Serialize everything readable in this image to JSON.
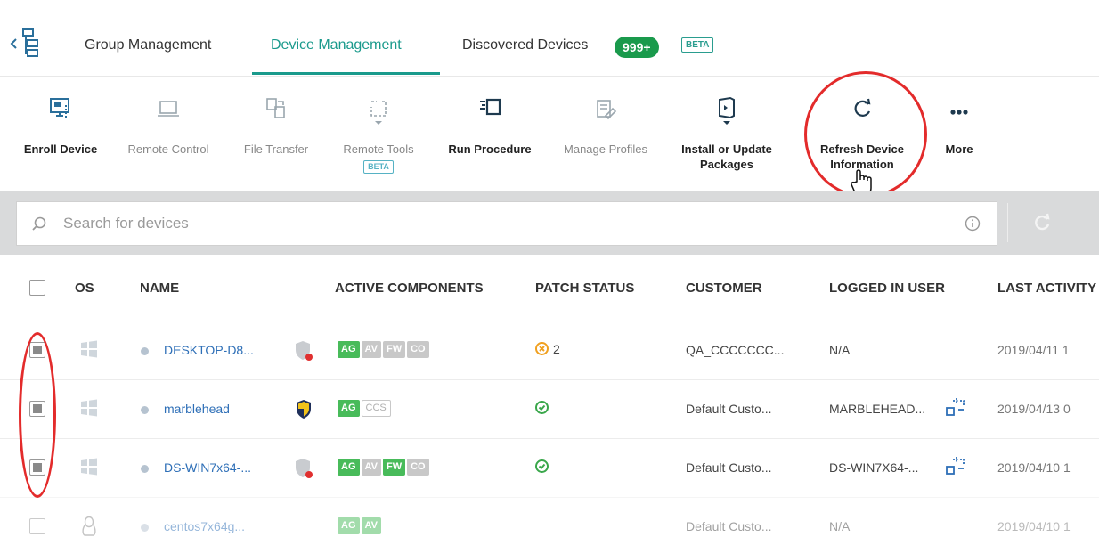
{
  "tabs": {
    "items": [
      {
        "label": "Group Management"
      },
      {
        "label": "Device Management"
      },
      {
        "label": "Discovered Devices"
      }
    ],
    "discovered_count": "999+",
    "discovered_beta": "BETA"
  },
  "toolbar": {
    "enroll": "Enroll Device",
    "remote_control": "Remote Control",
    "file_transfer": "File Transfer",
    "remote_tools": "Remote Tools",
    "remote_tools_beta": "BETA",
    "run_procedure": "Run Procedure",
    "manage_profiles": "Manage Profiles",
    "install_update": "Install or Update Packages",
    "refresh": "Refresh Device Information",
    "more": "More"
  },
  "search": {
    "placeholder": "Search for devices"
  },
  "table": {
    "headers": {
      "os": "OS",
      "name": "NAME",
      "active_components": "ACTIVE COMPONENTS",
      "patch_status": "PATCH STATUS",
      "customer": "CUSTOMER",
      "logged_in_user": "LOGGED IN USER",
      "last_activity": "LAST ACTIVITY"
    },
    "rows": [
      {
        "name": "DESKTOP-D8...",
        "components": [
          "AG",
          "AV",
          "FW",
          "CO"
        ],
        "patch": "2",
        "customer": "QA_CCCCCCC...",
        "user": "N/A",
        "last_activity": "2019/04/11 1"
      },
      {
        "name": "marblehead",
        "components": [
          "AG",
          "CCS"
        ],
        "patch": "",
        "customer": "Default Custo...",
        "user": "MARBLEHEAD...",
        "last_activity": "2019/04/13 0"
      },
      {
        "name": "DS-WIN7x64-...",
        "components": [
          "AG",
          "AV",
          "FW",
          "CO"
        ],
        "patch": "",
        "customer": "Default Custo...",
        "user": "DS-WIN7X64-...",
        "last_activity": "2019/04/10 1"
      },
      {
        "name": "centos7x64g...",
        "components": [
          "AG",
          "AV"
        ],
        "patch": "",
        "customer": "Default Custo...",
        "user": "N/A",
        "last_activity": "2019/04/10 1"
      }
    ]
  },
  "colors": {
    "accent": "#1a9a8c",
    "link": "#2e6fb7",
    "component_on": "#48bb5a",
    "component_off": "#c8c8c8",
    "annotation_red": "#e32b2b"
  }
}
